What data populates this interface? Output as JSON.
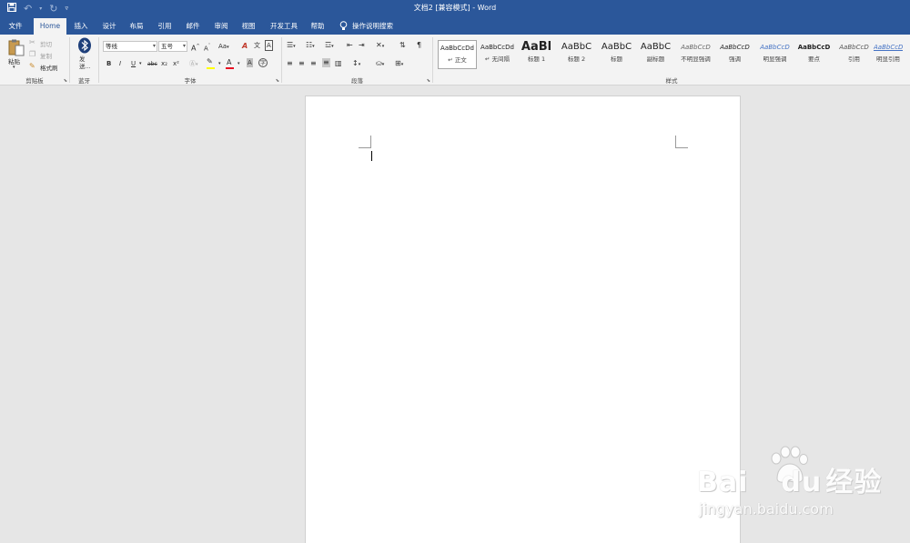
{
  "window": {
    "title": "文档2 [兼容模式]  -  Word"
  },
  "quick_access": {
    "save_icon": "save-icon",
    "undo_icon": "undo-icon",
    "redo_icon": "redo-icon",
    "customize_icon": "customize-qat-icon"
  },
  "tabs": [
    {
      "label": "文件"
    },
    {
      "label": "Home"
    },
    {
      "label": "插入"
    },
    {
      "label": "设计"
    },
    {
      "label": "布局"
    },
    {
      "label": "引用"
    },
    {
      "label": "邮件"
    },
    {
      "label": "审阅"
    },
    {
      "label": "视图"
    },
    {
      "label": "开发工具"
    },
    {
      "label": "帮助"
    },
    {
      "label": "操作说明搜索"
    }
  ],
  "active_tab": "Home",
  "ribbon": {
    "clipboard": {
      "paste_label": "粘贴",
      "cut_label": "剪切",
      "copy_label": "复制",
      "format_painter_label": "格式刷",
      "group_label": "剪贴板"
    },
    "bluetooth": {
      "send_label": "发送...",
      "group_label": "蓝牙"
    },
    "font": {
      "font_name": "等线",
      "font_size": "五号",
      "group_label": "字体",
      "bold": "B",
      "italic": "I",
      "underline": "U",
      "strike": "abc",
      "subscript": "x₂",
      "superscript": "x²",
      "grow": "A",
      "shrink": "A",
      "case": "Aa",
      "clear": "A",
      "phonetic": "文",
      "border": "A",
      "font_color": "A",
      "shade": "A",
      "enclose": "字"
    },
    "paragraph": {
      "group_label": "段落"
    },
    "styles": {
      "group_label": "样式",
      "items": [
        {
          "sample": "AaBbCcDd",
          "name": "↵ 正文"
        },
        {
          "sample": "AaBbCcDd",
          "name": "↵ 无间隔"
        },
        {
          "sample": "AaBl",
          "name": "标题 1"
        },
        {
          "sample": "AaBbC",
          "name": "标题 2"
        },
        {
          "sample": "AaBbC",
          "name": "标题"
        },
        {
          "sample": "AaBbC",
          "name": "副标题"
        },
        {
          "sample": "AaBbCcD",
          "name": "不明显强调"
        },
        {
          "sample": "AaBbCcD",
          "name": "强调"
        },
        {
          "sample": "AaBbCcD",
          "name": "明显强调"
        },
        {
          "sample": "AaBbCcD",
          "name": "要点"
        },
        {
          "sample": "AaBbCcD",
          "name": "引用"
        },
        {
          "sample": "AaBbCcD",
          "name": "明显引用"
        }
      ]
    }
  },
  "watermark": {
    "brand": "Bai",
    "brand2": "du",
    "cn": "经验",
    "url": "jingyan.baidu.com"
  },
  "colors": {
    "title_bar": "#2b579a",
    "ribbon": "#f3f3f3",
    "canvas": "#e6e6e6",
    "page": "#ffffff",
    "font_color_bar": "#e81123",
    "highlight_bar": "#ffff00"
  }
}
